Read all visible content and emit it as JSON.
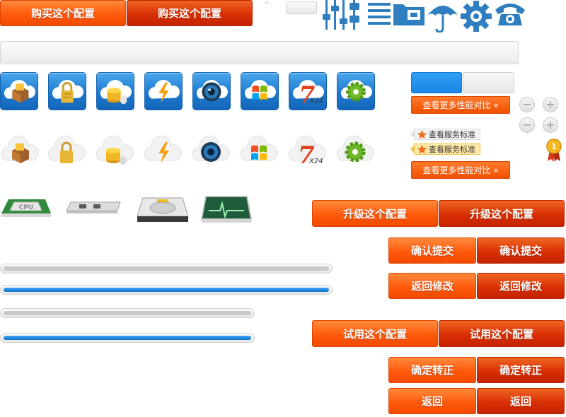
{
  "top_buttons": {
    "buy_a": "购买这个配置",
    "buy_b": "购买这个配置"
  },
  "caret_glyph": "^",
  "icons": [
    "sliders-icon",
    "settings-sliders-icon",
    "list-icon",
    "folder-open-icon",
    "umbrella-icon",
    "gear-icon",
    "telephone-icon"
  ],
  "service_tiles": [
    "package-cloud-icon",
    "lock-cloud-icon",
    "coins-cloud-icon",
    "lightning-cloud-icon",
    "camera-lens-cloud-icon",
    "windows-cloud-icon",
    "7x24-cloud-icon",
    "gear-cloud-icon"
  ],
  "tile_text_7x24": {
    "seven": "7",
    "x24": "X24"
  },
  "hardware_icons": [
    "cpu-chip-icon",
    "memory-module-icon",
    "hard-drive-icon",
    "monitor-pulse-icon"
  ],
  "cpu_label": "CPU",
  "compare_link": {
    "label": "查看更多性能对比 »"
  },
  "compare_link_2": {
    "label": "查看更多性能对比 »"
  },
  "tags": {
    "t1": "查看服务标准",
    "t2": "查看服务标准"
  },
  "stepper": {
    "minus": "−",
    "plus": "+"
  },
  "badge_number": "1",
  "progress": [
    {
      "fill": 0
    },
    {
      "fill": 1
    },
    {
      "fill": 0
    },
    {
      "fill": 1
    }
  ],
  "buttons": {
    "upgrade_a": "升级这个配置",
    "upgrade_b": "升级这个配置",
    "confirm_a": "确认提交",
    "confirm_b": "确认提交",
    "back_edit_a": "返回修改",
    "back_edit_b": "返回修改",
    "trial_a": "试用这个配置",
    "trial_b": "试用这个配置",
    "convert_a": "确定转正",
    "convert_b": "确定转正",
    "return_a": "返回",
    "return_b": "返回"
  },
  "colors": {
    "orange_light": "#ff5a0c",
    "orange_dark": "#d92f05",
    "blue": "#1d79cf",
    "icon_blue": "#2f7fc0"
  }
}
